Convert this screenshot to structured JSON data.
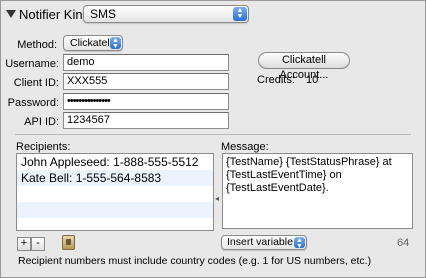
{
  "header": {
    "kind_label": "Notifier Kind:",
    "kind_value": "SMS"
  },
  "method": {
    "label": "Method:",
    "value": "Clickatell"
  },
  "username": {
    "label": "Username:",
    "value": "demo"
  },
  "client_id": {
    "label": "Client ID:",
    "value": "XXX555"
  },
  "password": {
    "label": "Password:",
    "value": "•••••••••••••••"
  },
  "api_id": {
    "label": "API ID:",
    "value": "1234567"
  },
  "account_button": "Clickatell Account...",
  "credits": {
    "label": "Credits:",
    "value": "10"
  },
  "recipients": {
    "label": "Recipients:",
    "rows": [
      "John Appleseed: 1-888-555-5512",
      "Kate Bell: 1-555-564-8583"
    ]
  },
  "message": {
    "label": "Message:",
    "text": "{TestName} {TestStatusPhrase} at {TestLastEventTime} on {TestLastEventDate}."
  },
  "insert_variable": "Insert variable",
  "char_count": "64",
  "add_label": "+",
  "remove_label": "-",
  "note": "Recipient numbers must include country codes (e.g. 1 for US numbers, etc.)",
  "colors": {
    "accent": "#2a6fd6",
    "alt_row": "#edf3fe"
  }
}
